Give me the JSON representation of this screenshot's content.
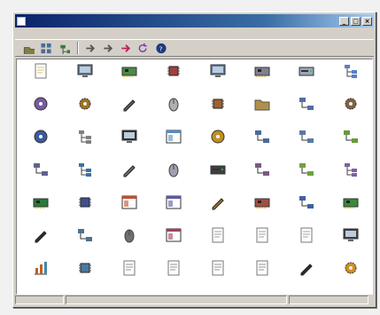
{
  "window": {
    "title": ""
  },
  "menu": [
    {
      "id": "menu-1",
      "label": ""
    },
    {
      "id": "menu-2",
      "label": ""
    },
    {
      "id": "menu-3",
      "label": ""
    },
    {
      "id": "menu-4",
      "label": ""
    }
  ],
  "toolbar": [
    {
      "name": "up-folder-icon",
      "icon": "folder",
      "color": "#808040"
    },
    {
      "name": "view-icon",
      "icon": "grid",
      "color": "#4a6c9b"
    },
    {
      "name": "tree-icon",
      "icon": "tree",
      "color": "#3a7a3a"
    },
    {
      "sep": true
    },
    {
      "name": "cut-icon",
      "icon": "arrow",
      "color": "#555"
    },
    {
      "name": "back-icon",
      "icon": "arrow",
      "color": "#555"
    },
    {
      "name": "forward-icon",
      "icon": "arrow",
      "color": "#c0205a"
    },
    {
      "name": "refresh-icon",
      "icon": "refresh",
      "color": "#7a3aa0"
    },
    {
      "name": "help-icon",
      "icon": "help",
      "color": "#203a80"
    }
  ],
  "items": [
    {
      "label": "",
      "icon": "doc",
      "color": "#e0c060"
    },
    {
      "label": "",
      "icon": "monitor",
      "color": "#607890"
    },
    {
      "label": "",
      "icon": "card",
      "color": "#4a8a4a"
    },
    {
      "label": "",
      "icon": "chip",
      "color": "#a04040"
    },
    {
      "label": "",
      "icon": "monitor",
      "color": "#5a7aa8"
    },
    {
      "label": "",
      "icon": "card",
      "color": "#808090"
    },
    {
      "label": "",
      "icon": "drive",
      "color": "#9aa6b8"
    },
    {
      "label": "",
      "icon": "tree",
      "color": "#5a80c0"
    },
    {
      "label": "",
      "icon": "disc",
      "color": "#7a5aa0"
    },
    {
      "label": "",
      "icon": "gear",
      "color": "#a07020"
    },
    {
      "label": "",
      "icon": "pen",
      "color": "#606060"
    },
    {
      "label": "",
      "icon": "mouse",
      "color": "#b0b0b0"
    },
    {
      "label": "",
      "icon": "chip",
      "color": "#a06030"
    },
    {
      "label": "",
      "icon": "folder",
      "color": "#b0904a"
    },
    {
      "label": "",
      "icon": "network",
      "color": "#5070a0"
    },
    {
      "label": "",
      "icon": "gear",
      "color": "#806040"
    },
    {
      "label": "",
      "icon": "disc",
      "color": "#3a5aa0"
    },
    {
      "label": "",
      "icon": "tree",
      "color": "#808080"
    },
    {
      "label": "",
      "icon": "monitor",
      "color": "#303030"
    },
    {
      "label": "",
      "icon": "window",
      "color": "#5a8ac0"
    },
    {
      "label": "",
      "icon": "disc",
      "color": "#c09020"
    },
    {
      "label": "",
      "icon": "network",
      "color": "#4a6a9a"
    },
    {
      "label": "",
      "icon": "network",
      "color": "#5a7aa0"
    },
    {
      "label": "",
      "icon": "network",
      "color": "#6a9a3a"
    },
    {
      "label": "",
      "icon": "network",
      "color": "#606090"
    },
    {
      "label": "",
      "icon": "tree",
      "color": "#4070a0"
    },
    {
      "label": "",
      "icon": "pen",
      "color": "#707070"
    },
    {
      "label": "",
      "icon": "mouse",
      "color": "#a0a0b0"
    },
    {
      "label": "",
      "icon": "drive",
      "color": "#404040"
    },
    {
      "label": "",
      "icon": "network",
      "color": "#7a5a80"
    },
    {
      "label": "",
      "icon": "network",
      "color": "#70a040"
    },
    {
      "label": "",
      "icon": "tree",
      "color": "#8060a0"
    },
    {
      "label": "",
      "icon": "card",
      "color": "#2a7a3a"
    },
    {
      "label": "",
      "icon": "chip",
      "color": "#405090"
    },
    {
      "label": "",
      "icon": "window",
      "color": "#c05030"
    },
    {
      "label": "",
      "icon": "window",
      "color": "#5a5aa0"
    },
    {
      "label": "",
      "icon": "pen",
      "color": "#a07a30"
    },
    {
      "label": "",
      "icon": "card",
      "color": "#a05040"
    },
    {
      "label": "",
      "icon": "network",
      "color": "#4060a0"
    },
    {
      "label": "",
      "icon": "card",
      "color": "#3a8a3a"
    },
    {
      "label": "",
      "icon": "pen",
      "color": "#303030"
    },
    {
      "label": "",
      "icon": "network",
      "color": "#507090"
    },
    {
      "label": "",
      "icon": "mouse",
      "color": "#707070"
    },
    {
      "label": "",
      "icon": "window",
      "color": "#a04060"
    },
    {
      "label": "",
      "icon": "doc",
      "color": "#a0a0a0"
    },
    {
      "label": "",
      "icon": "doc",
      "color": "#a0a0a0"
    },
    {
      "label": "",
      "icon": "doc",
      "color": "#a0a0a0"
    },
    {
      "label": "",
      "icon": "monitor",
      "color": "#404040"
    },
    {
      "label": "",
      "icon": "chart",
      "color": "#c06020"
    },
    {
      "label": "",
      "icon": "chip",
      "color": "#4a7aa0"
    },
    {
      "label": "",
      "icon": "doc",
      "color": "#909090"
    },
    {
      "label": "",
      "icon": "doc",
      "color": "#909090"
    },
    {
      "label": "",
      "icon": "doc",
      "color": "#909090"
    },
    {
      "label": "",
      "icon": "doc",
      "color": "#909090"
    },
    {
      "label": "",
      "icon": "pen",
      "color": "#303030"
    },
    {
      "label": "",
      "icon": "gear",
      "color": "#d09020"
    }
  ],
  "statusbar": [
    {
      "text": ""
    },
    {
      "text": ""
    },
    {
      "text": ""
    }
  ]
}
